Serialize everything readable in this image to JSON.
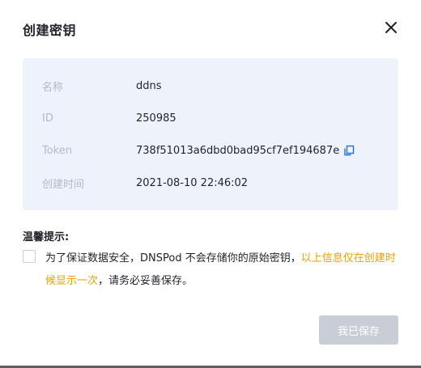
{
  "dialog": {
    "title": "创建密钥",
    "close_icon": "close-icon"
  },
  "info": {
    "rows": [
      {
        "label": "名称",
        "value": "ddns"
      },
      {
        "label": "ID",
        "value": "250985"
      },
      {
        "label": "Token",
        "value": "738f51013a6dbd0bad95cf7ef194687e",
        "icon": "copy-icon"
      },
      {
        "label": "创建时间",
        "value": "2021-08-10 22:46:02"
      }
    ]
  },
  "tip": {
    "title": "温馨提示:",
    "text_before": "为了保证数据安全，DNSPod 不会存储你的原始密钥，",
    "text_highlight": "以上信息仅在创建时候显示一次",
    "text_after": "，请务必妥善保存。",
    "checked": false
  },
  "footer": {
    "save_label": "我已保存",
    "save_disabled": true
  },
  "colors": {
    "panel_bg": "#eef3fb",
    "label": "#b2b9c7",
    "highlight": "#e8a300",
    "button_disabled": "#c9ced6"
  }
}
